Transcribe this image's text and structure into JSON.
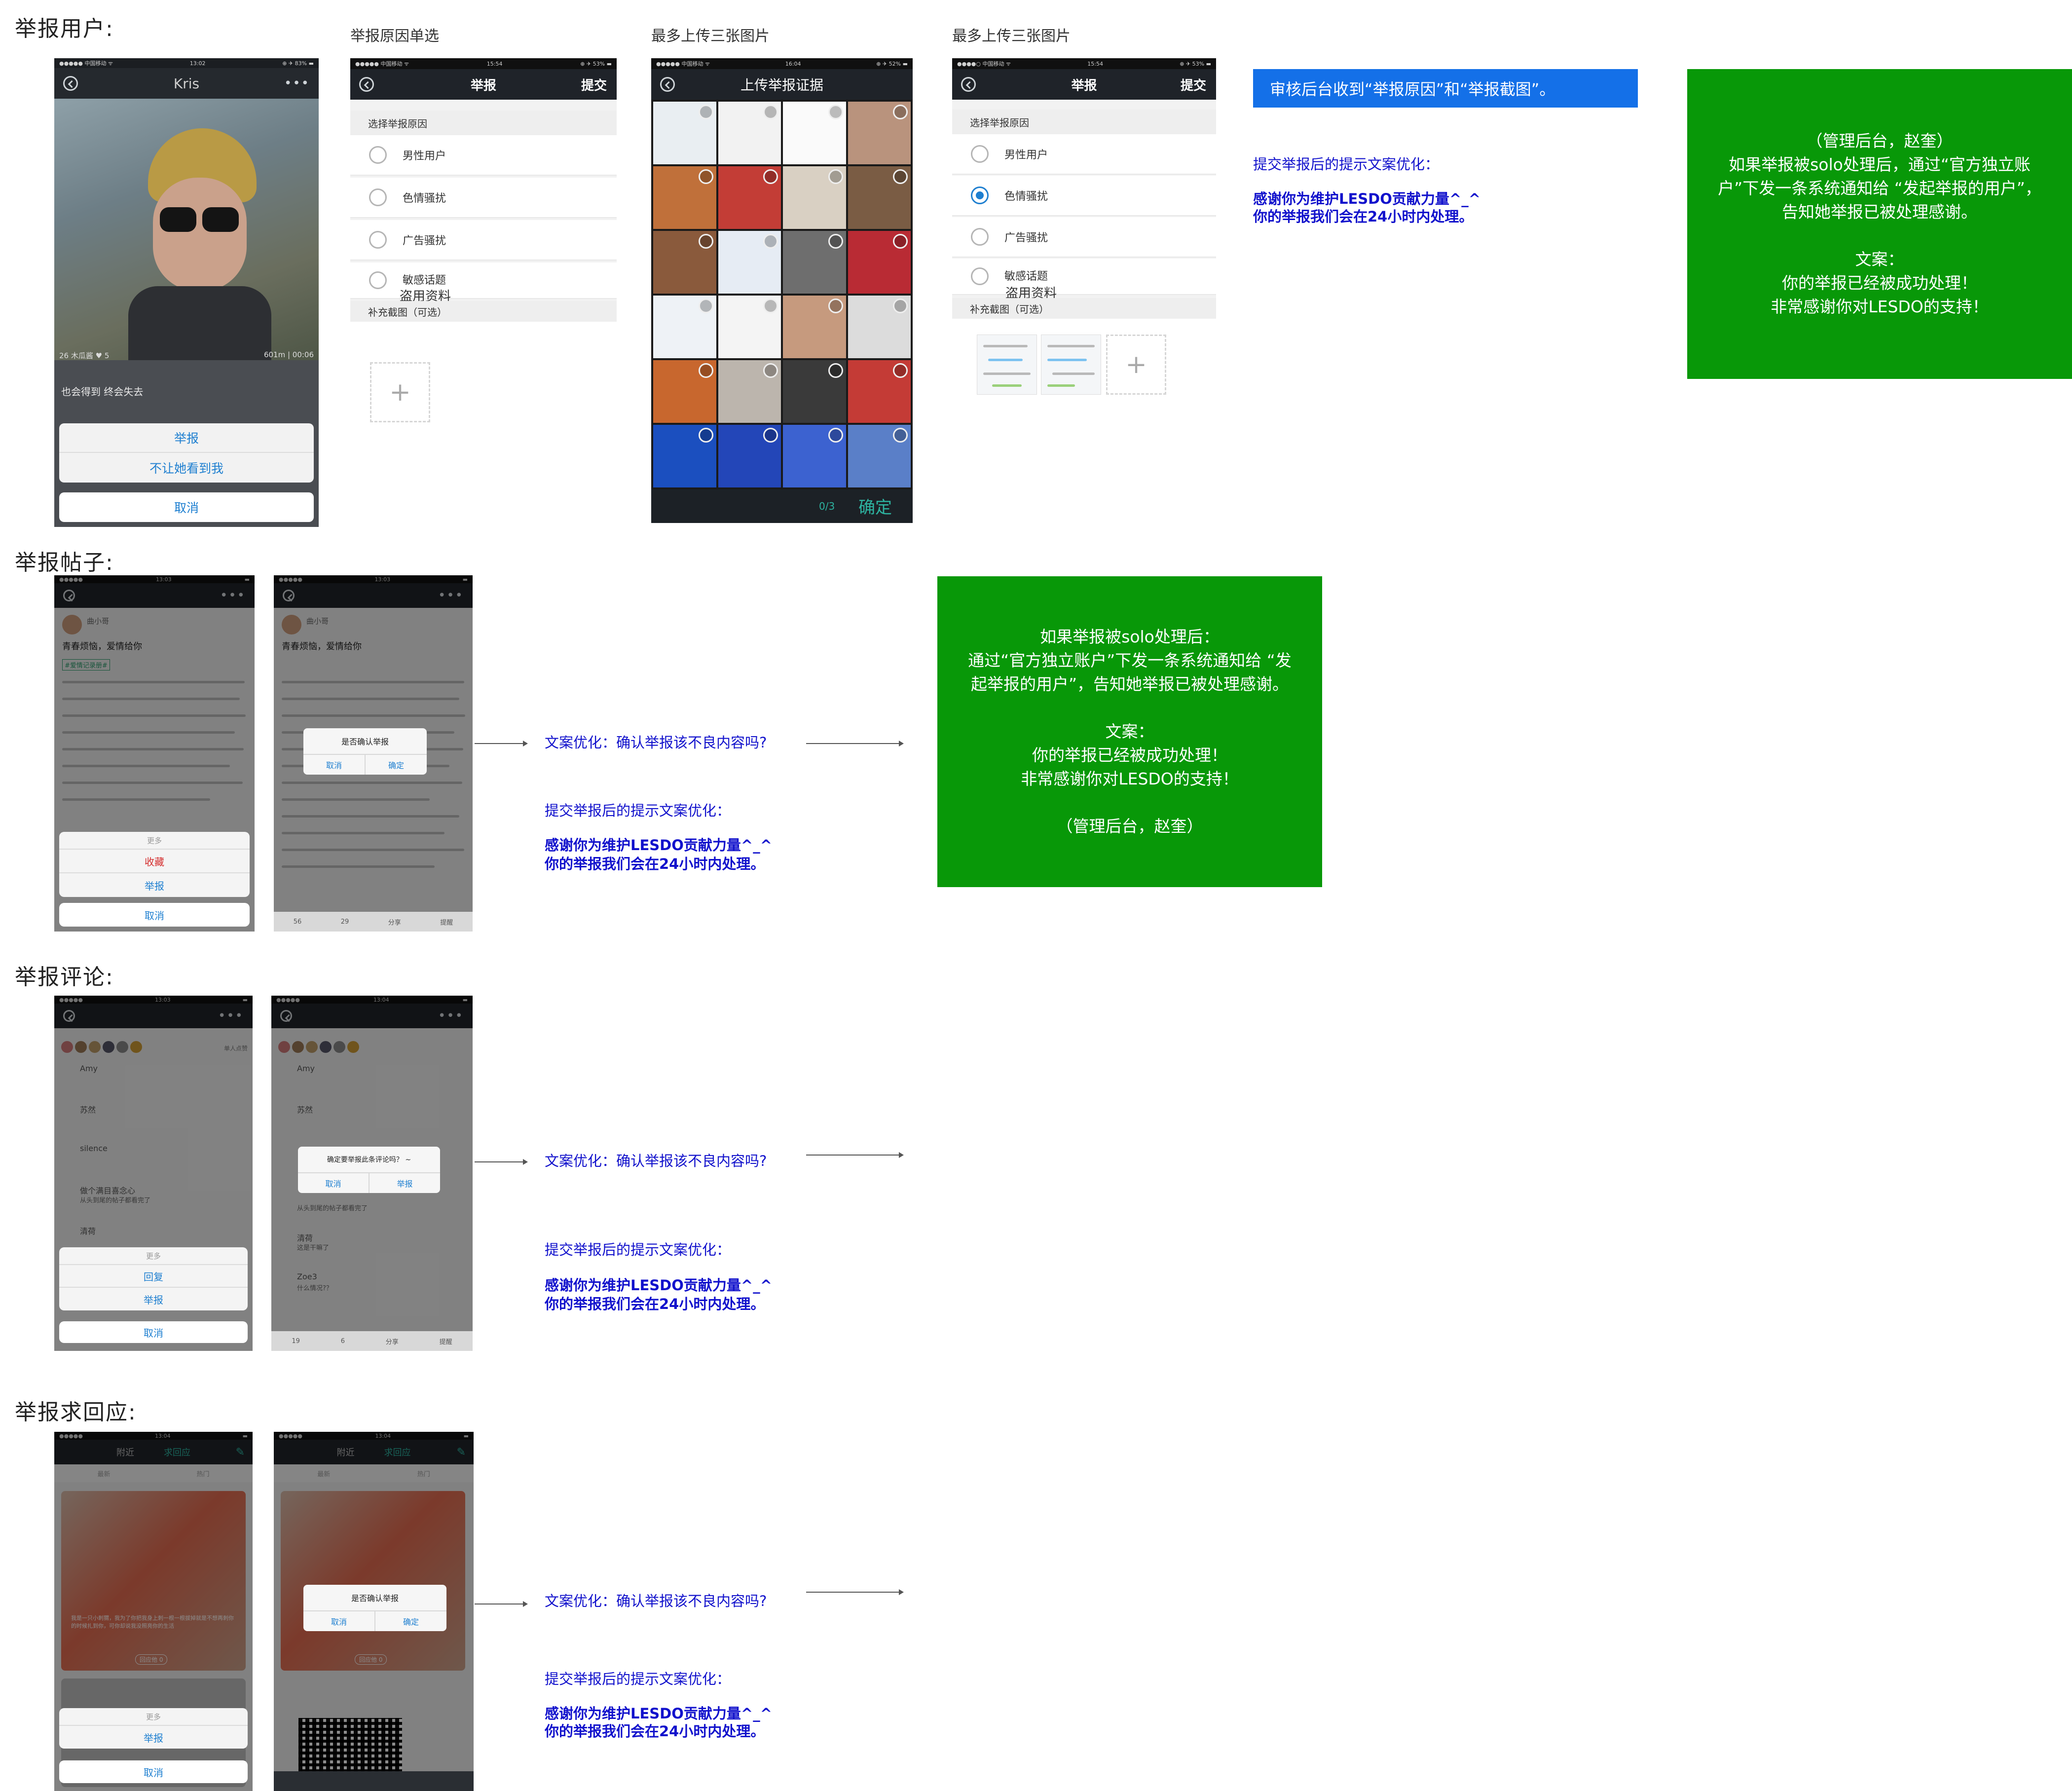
{
  "sections": {
    "user": "举报用户:",
    "post": "举报帖子:",
    "comment": "举报评论:",
    "help": "举报求回应:"
  },
  "captions": {
    "reason_single": "举报原因单选",
    "upload_max_a": "最多上传三张图片",
    "upload_max_b": "最多上传三张图片"
  },
  "colors": {
    "green_box": "#089808",
    "blue_banner": "#1470e8",
    "blue_text": "#1111cc",
    "nav_dark": "#1f2329",
    "ios_blue": "#1e7fd0"
  },
  "user_profile": {
    "status_left": "●●●●● 中国移动 ᯤ",
    "status_time": "13:02",
    "status_right": "⊕ ✈ 83% ▬",
    "name": "Kris",
    "stats_left": "26  木瓜酱  ♥ 5",
    "stats_right": "601m | 00:06",
    "bio": "也会得到 终会失去",
    "sheet_report": "举报",
    "sheet_block": "不让她看到我",
    "sheet_cancel": "取消"
  },
  "report_form": {
    "status_left": "●●●●● 中国移动 ᯤ",
    "status_time": "15:54",
    "status_right": "⊕ ✈ 53% ▬",
    "title": "举报",
    "submit": "提交",
    "choose_reason": "选择举报原因",
    "options": [
      "男性用户",
      "色情骚扰",
      "广告骚扰",
      "敏感话题"
    ],
    "option_extra": "盗用资料",
    "supplement": "补充截图（可选）",
    "plus": "+"
  },
  "upload_screen": {
    "status_left": "●●●●● 中国移动 ᯤ",
    "status_time": "16:04",
    "status_right": "⊕ ✈ 52% ▬",
    "title": "上传举报证据",
    "counter": "0/3",
    "confirm": "确定"
  },
  "report_form_filled": {
    "status_left": "●●●●○ 中国移动 ᯤ",
    "status_time": "15:54",
    "status_right": "⊕ ✈ 53% ▬",
    "title": "举报",
    "submit": "提交",
    "choose_reason": "选择举报原因",
    "options": [
      "男性用户",
      "色情骚扰",
      "广告骚扰",
      "敏感话题"
    ],
    "option_extra": "盗用资料",
    "supplement": "补充截图（可选）",
    "selected_index": 1,
    "plus": "+"
  },
  "banner_text": "审核后台收到“举报原因”和“举报截图”。",
  "user_note": {
    "title": "提交举报后的提示文案优化：",
    "line1": "感谢你为维护LESDO贡献力量^_^",
    "line2": "你的举报我们会在24小时内处理。"
  },
  "green_user": {
    "line1": "（管理后台，赵奎）",
    "line2": "如果举报被solo处理后，通过“官方独立账",
    "line3": "户”下发一条系统通知给 “发起举报的用户”，",
    "line4": "告知她举报已被处理感谢。",
    "line5": "文案：",
    "line6": "你的举报已经被成功处理！",
    "line7": "非常感谢你对LESDO的支持！"
  },
  "post_screens": {
    "status_time_a": "13:03",
    "status_time_b": "13:03",
    "author": "曲小哥",
    "headline": "青春烦恼，爱情给你",
    "tag": "#爱情记录册#",
    "sheet_more": "更多",
    "sheet_collect": "收藏",
    "sheet_report": "举报",
    "sheet_cancel": "取消",
    "dlg_title": "是否确认举报",
    "dlg_cancel": "取消",
    "dlg_ok": "确定",
    "bottom_counts": [
      "56",
      "29",
      "分享",
      "提醒"
    ]
  },
  "green_post": {
    "line1": "如果举报被solo处理后：",
    "line2": "通过“官方独立账户”下发一条系统通知给 “发",
    "line3": "起举报的用户”，告知她举报已被处理感谢。",
    "line4": "文案：",
    "line5": "你的举报已经被成功处理！",
    "line6": "非常感谢你对LESDO的支持！",
    "line7": "（管理后台，赵奎）"
  },
  "comment_screens": {
    "status_time_a": "13:03",
    "status_time_b": "13:04",
    "header_right": "单人点赞",
    "commenters": [
      "Amy",
      "苏然",
      "silence",
      "做个满目喜念心",
      "清荷"
    ],
    "commenters_b": [
      "Amy",
      "苏然",
      "Zoe",
      "清荷",
      "Zoe3"
    ],
    "reply_b": "从头到尾的帖子都看完了",
    "reply_b2": "这是干嘛了",
    "reply_b3": "什么情况?？",
    "reply_a": "从头到尾的帖子都看完了",
    "sheet_more": "更多",
    "sheet_reply": "回复",
    "sheet_report": "举报",
    "sheet_cancel": "取消",
    "dlg_title": "确定要举报此条评论吗？ ~",
    "dlg_cancel": "取消",
    "dlg_ok": "举报",
    "bottom_counts": [
      "19",
      "6",
      "分享",
      "提醒"
    ]
  },
  "help_screens": {
    "status_time_a": "13:04",
    "status_time_b": "13:04",
    "tab_nearby": "附近",
    "tab_help": "求回应",
    "sub_new": "最新",
    "sub_hot": "热门",
    "card_text": "我是一只小刺猬，我为了你把我身上刺一根一根拔掉就是不想再刺你的时候扎到你，可你却说我没照亮你的生活",
    "reply_btn": "回应他 0",
    "sheet_more": "更多",
    "sheet_report": "举报",
    "sheet_cancel": "取消",
    "dlg_title": "是否确认举报",
    "dlg_cancel": "取消",
    "dlg_ok": "确定"
  },
  "notes": {
    "confirm_copy": "文案优化：确认举报该不良内容吗?",
    "after_title": "提交举报后的提示文案优化：",
    "after_line1": "感谢你为维护LESDO贡献力量^_^",
    "after_line2": "你的举报我们会在24小时内处理。"
  }
}
